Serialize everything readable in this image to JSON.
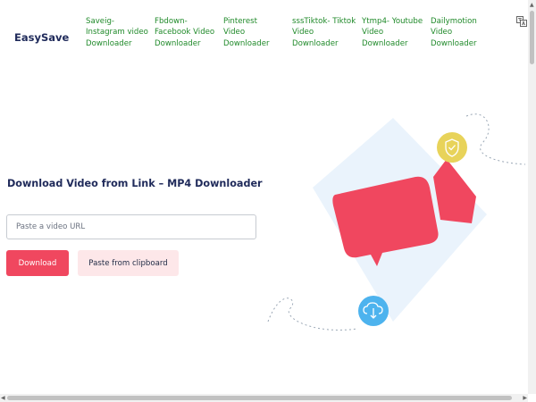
{
  "header": {
    "brand": "EasySave",
    "nav": [
      "Saveig- Instagram video Downloader",
      "Fbdown- Facebook Video Downloader",
      "Pinterest Video Downloader",
      "sssTiktok- Tiktok Video Downloader",
      "Ytmp4- Youtube Video Downloader",
      "Dailymotion Video Downloader"
    ],
    "language_icon": "translate-icon"
  },
  "hero": {
    "title": "Download Video from Link – MP4 Downloader",
    "input_placeholder": "Paste a video URL",
    "input_value": "",
    "download_label": "Download",
    "paste_label": "Paste from clipboard"
  },
  "illustration": {
    "icons": [
      "shield-check-icon",
      "cloud-download-icon",
      "video-camera-icon"
    ]
  },
  "colors": {
    "brand_text": "#1f2a5a",
    "nav_link": "#208a2a",
    "primary": "#f0475f",
    "secondary_bg": "#fde7e9",
    "shield_circle": "#e8d35a",
    "cloud_circle": "#4db3ee"
  }
}
